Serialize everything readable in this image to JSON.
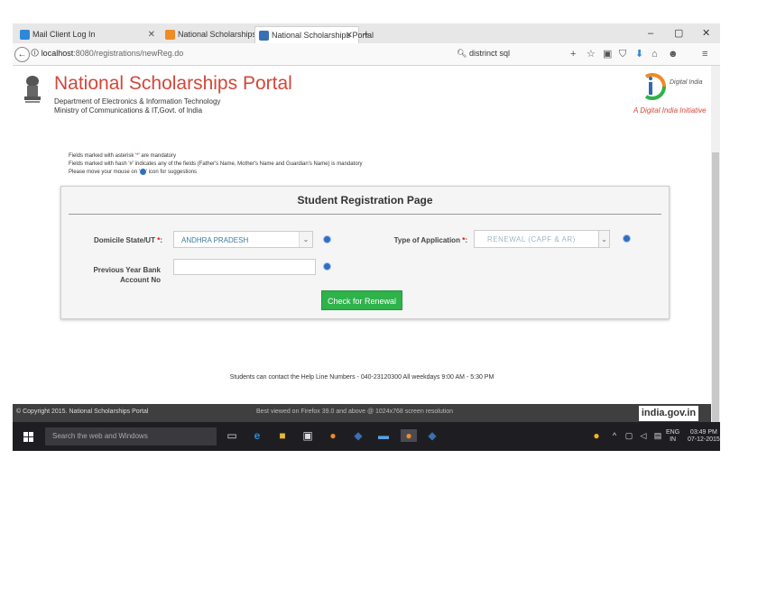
{
  "browser": {
    "tabs": [
      {
        "label": "Mail Client Log In",
        "icon_color": "#2d89d8"
      },
      {
        "label": "National Scholarships Portal",
        "icon_color": "#f08a24"
      },
      {
        "label": "National Scholarships Portal",
        "icon_color": "#3b6fb5"
      }
    ],
    "new_tab_symbol": "+",
    "url_host": "localhost",
    "url_rest": ":8080/registrations/newReg.do",
    "search_text": "distrinct sql",
    "window_controls": [
      "–",
      "▢",
      "✕"
    ],
    "nav_icons": [
      "+",
      "☆",
      "▣",
      "⛉",
      "⬇",
      "⌂",
      "☻",
      "≡"
    ]
  },
  "header": {
    "title": "National Scholarships Portal",
    "subtitle1": "Department of Electronics & Information Technology",
    "subtitle2": "Ministry of Communications & IT,Govt. of India",
    "di_logo_text": "Digital India",
    "di_tagline": "A Digital India Initiative"
  },
  "notes": {
    "line1_a": "Fields marked with asterisk '",
    "line1_ast": "*",
    "line1_b": "' are mandatory",
    "line2": "Fields marked with hash '#' indicates any of the fields (Father's Name, Mother's Name and Guardian's Name) is mandatory",
    "line3_a": "Please move your mouse on '",
    "line3_b": "' icon for suggestions"
  },
  "form": {
    "title": "Student Registration Page",
    "domicile_label": "Domicile State/UT",
    "domicile_value": "ANDHRA PRADESH",
    "type_label": "Type of Application",
    "type_value": "RENEWAL (CAPF & AR)",
    "bank_label_1": "Previous Year Bank",
    "bank_label_2": "Account No",
    "bank_value": "",
    "asterisk": "*",
    "colon": ":",
    "caret": "⌄",
    "submit_label": "Check for Renewal"
  },
  "helpline": "Students can contact the Help Line Numbers - 040-23120300 All weekdays 9:00 AM - 5:30 PM",
  "footer": {
    "copyright": "© Copyright 2015. National Scholarships Portal",
    "best_viewed": "Best viewed on Firefox 39.0 and above @ 1024x768 screen resolution",
    "india_logo": "india.gov.in"
  },
  "taskbar": {
    "search_placeholder": "Search the web and Windows",
    "lang_1": "ENG",
    "lang_2": "IN",
    "time": "03:49 PM",
    "date": "07-12-2015"
  },
  "colors": {
    "title_red": "#d2473a",
    "button_green": "#2eb24a",
    "hint_blue": "#2f6fc4"
  }
}
